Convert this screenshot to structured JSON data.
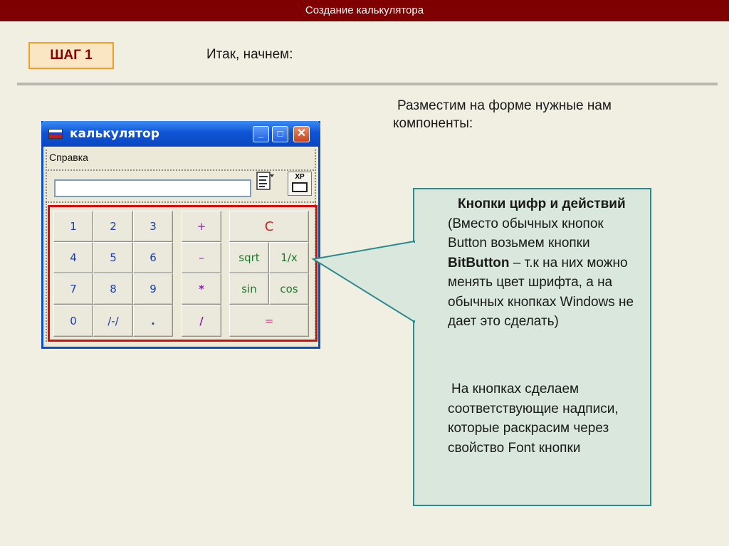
{
  "header": {
    "title": "Создание калькулятора"
  },
  "step": {
    "badge": "ШАГ 1",
    "intro": "Итак, начнем:"
  },
  "instruction": "Разместим на форме нужные нам компоненты:",
  "window": {
    "title": "калькулятор",
    "menu": "Справка",
    "xp_icon_label": "XP",
    "title_buttons": {
      "minimize": "_",
      "maximize": "□",
      "close": "✕"
    }
  },
  "keypad": {
    "digit_buttons": [
      "1",
      "2",
      "3",
      "4",
      "5",
      "6",
      "7",
      "8",
      "9",
      "0",
      "/-/",
      "."
    ],
    "operator_buttons": [
      "+",
      "–",
      "*",
      "/"
    ],
    "function_buttons": {
      "clear": "C",
      "sqrt": "sqrt",
      "reciprocal": "1/x",
      "sin": "sin",
      "cos": "cos",
      "equals": "="
    }
  },
  "colors": {
    "header_bg": "#7f0000",
    "digit_text": "#1a3ea8",
    "operator_text": "#8a1fb0",
    "clear_text": "#d21d1d",
    "function_text": "#1d7a2d",
    "equals_text": "#d23a8e",
    "highlight_border": "#d60b0b",
    "callout_border": "#2a8a8e",
    "callout_bg": "#d9e7dc"
  },
  "callout": {
    "p1_lead": "Кнопки цифр и действий",
    "p1_rest1": " (Вместо обычных кнопок Button возьмем кнопки ",
    "p1_bold2": "BitButton",
    "p1_rest2": " – т.к на них можно менять цвет шрифта, а на обычных кнопках Windows не дает это сделать)",
    "p2": "На кнопках сделаем соответствующие надписи, которые раскрасим через свойство Font кнопки"
  }
}
